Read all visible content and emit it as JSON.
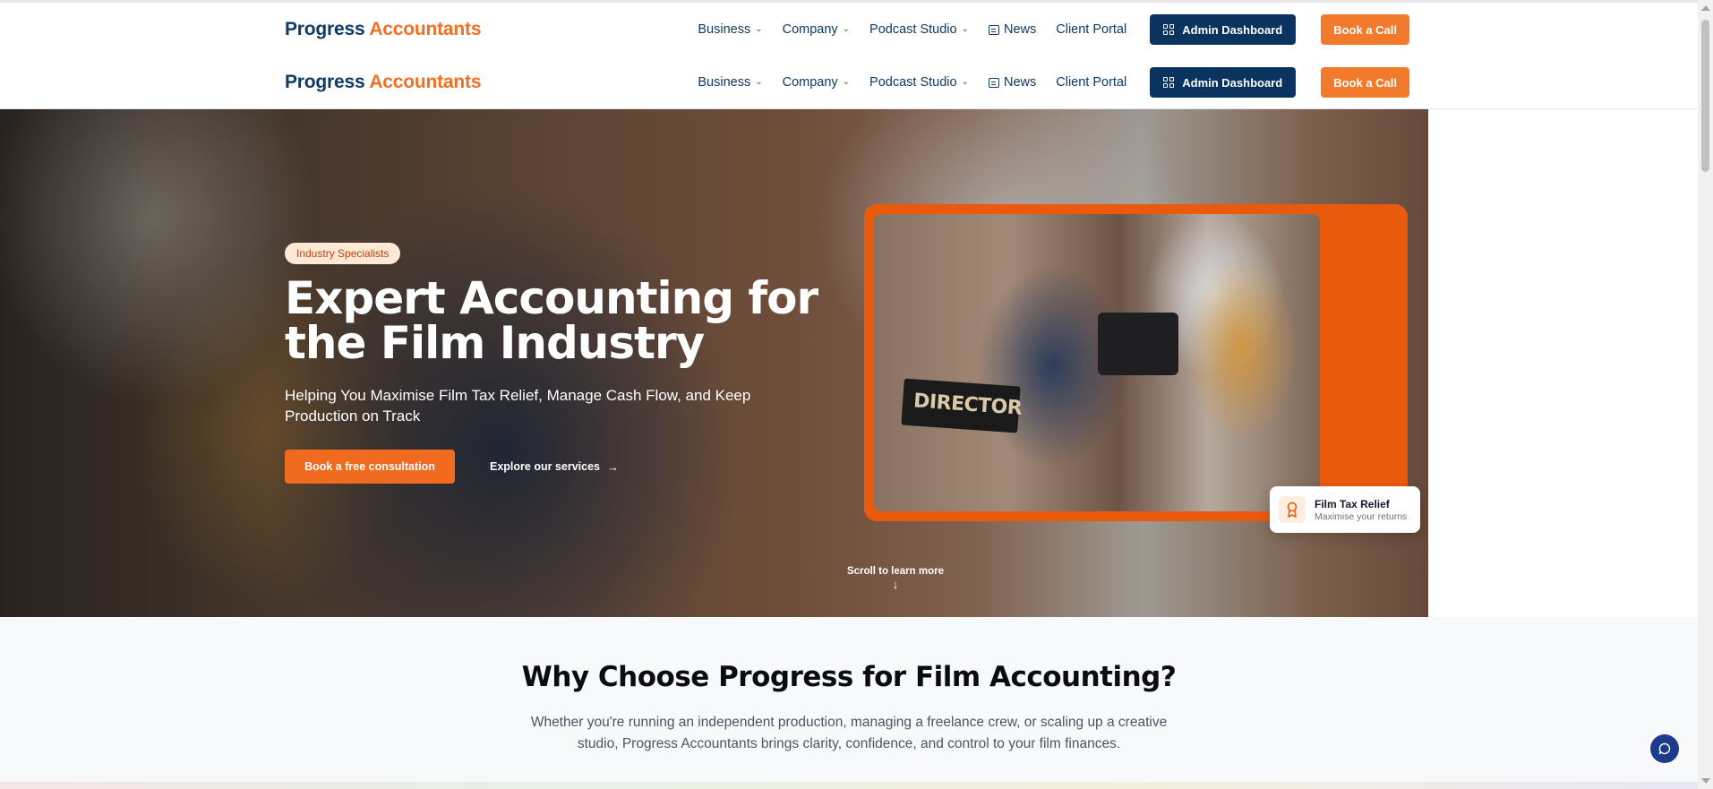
{
  "brand": {
    "name_part1": "Progress",
    "name_part2": "Accountants",
    "accent_color": "#f06f22",
    "primary_color": "#0f3a64"
  },
  "nav": {
    "items": [
      {
        "label": "Business",
        "has_dropdown": true
      },
      {
        "label": "Company",
        "has_dropdown": true
      },
      {
        "label": "Podcast Studio",
        "has_dropdown": true
      },
      {
        "label": "News",
        "icon": "newspaper-icon"
      },
      {
        "label": "Client Portal"
      }
    ],
    "admin_button": "Admin Dashboard",
    "cta_button": "Book a Call"
  },
  "hero": {
    "badge": "Industry Specialists",
    "title": "Expert Accounting for the Film Industry",
    "subtitle": "Helping You Maximise Film Tax Relief, Manage Cash Flow, and Keep Production on Track",
    "primary_cta": "Book a free consultation",
    "secondary_cta": "Explore our services",
    "scroll_hint": "Scroll to learn more",
    "image_text": "DIRECTOR",
    "relief_card": {
      "title": "Film Tax Relief",
      "subtitle": "Maximise your returns",
      "icon": "award-icon"
    }
  },
  "why": {
    "title": "Why Choose Progress for Film Accounting?",
    "body": "Whether you're running an independent production, managing a freelance crew, or scaling up a creative studio, Progress Accountants brings clarity, confidence, and control to your film finances."
  },
  "chat": {
    "icon": "chat-icon"
  }
}
